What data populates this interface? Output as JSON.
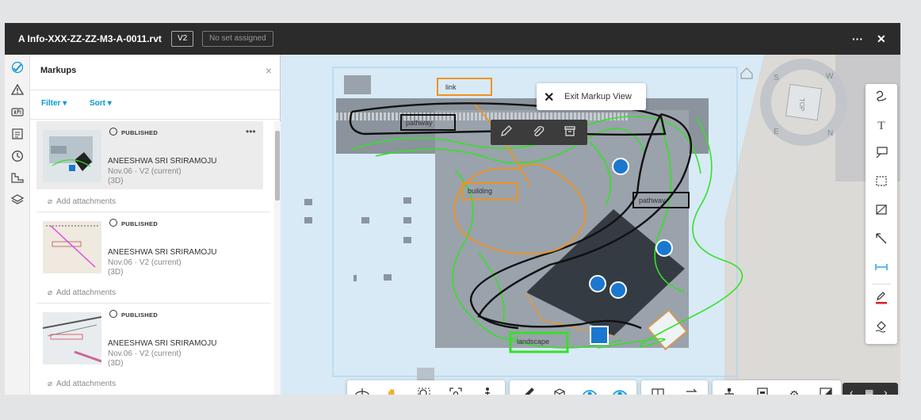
{
  "window": {
    "title": "A Info-XXX-ZZ-ZZ-M3-A-0011.rvt",
    "version": "V2",
    "set": "No set assigned",
    "more": "···",
    "close": "✕"
  },
  "rail": {
    "icons": [
      "markup-check-icon",
      "warning-icon",
      "api-icon",
      "sheets-icon",
      "history-icon",
      "measure-icon",
      "layers-icon"
    ]
  },
  "panel": {
    "title": "Markups",
    "close": "×",
    "filter": "Filter",
    "sort": "Sort"
  },
  "markups": [
    {
      "status": "PUBLISHED",
      "author": "ANEESHWA SRI SRIRAMOJU",
      "date": "Nov.06 · V2 (current)",
      "view": "(3D)",
      "attach": "Add attachments"
    },
    {
      "status": "PUBLISHED",
      "author": "ANEESHWA SRI SRIRAMOJU",
      "date": "Nov.06 · V2 (current)",
      "view": "(3D)",
      "attach": "Add attachments"
    },
    {
      "status": "PUBLISHED",
      "author": "ANEESHWA SRI SRIRAMOJU",
      "date": "Nov.06 · V2 (current)",
      "view": "(3D)",
      "attach": "Add attachments"
    }
  ],
  "exit": {
    "label": "Exit Markup View"
  },
  "labels": {
    "link": "link",
    "pathway1": "pathway",
    "building": "building",
    "pathway2": "pathway",
    "landscape": "landscape"
  },
  "viewcube": {
    "top": "TOP",
    "s": "S",
    "w": "W",
    "e": "E",
    "n": "N"
  },
  "colors": {
    "orange": "#f0921e",
    "green": "#35e02a",
    "black": "#111111",
    "blue": "#1a78d0",
    "accent": "#0696d7",
    "pen_red": "#e02020"
  }
}
